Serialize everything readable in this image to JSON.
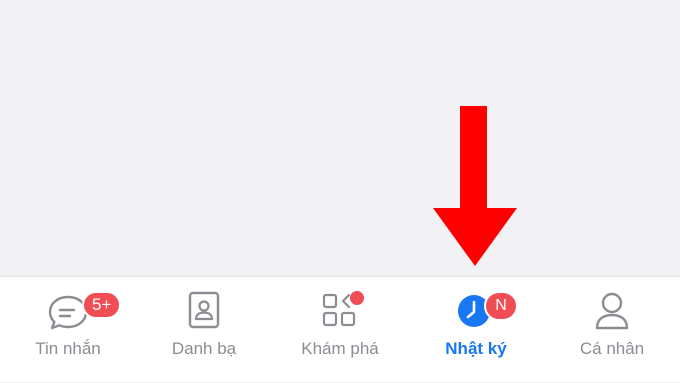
{
  "colors": {
    "accent": "#1877f2",
    "badge": "#f04d55",
    "inactive": "#8a8d92",
    "arrow": "#ff0000"
  },
  "annotation": {
    "icon": "red-down-arrow"
  },
  "tab_bar": {
    "tabs": [
      {
        "id": "messages",
        "label": "Tin nhắn",
        "icon": "chat-bubble-icon",
        "badge": "5+",
        "active": false
      },
      {
        "id": "contacts",
        "label": "Danh bạ",
        "icon": "contact-card-icon",
        "active": false
      },
      {
        "id": "discover",
        "label": "Khám phá",
        "icon": "grid-apps-icon",
        "badge_dot": true,
        "active": false
      },
      {
        "id": "diary",
        "label": "Nhật ký",
        "icon": "clock-icon",
        "badge": "N",
        "active": true
      },
      {
        "id": "profile",
        "label": "Cá nhân",
        "icon": "person-icon",
        "active": false
      }
    ]
  }
}
